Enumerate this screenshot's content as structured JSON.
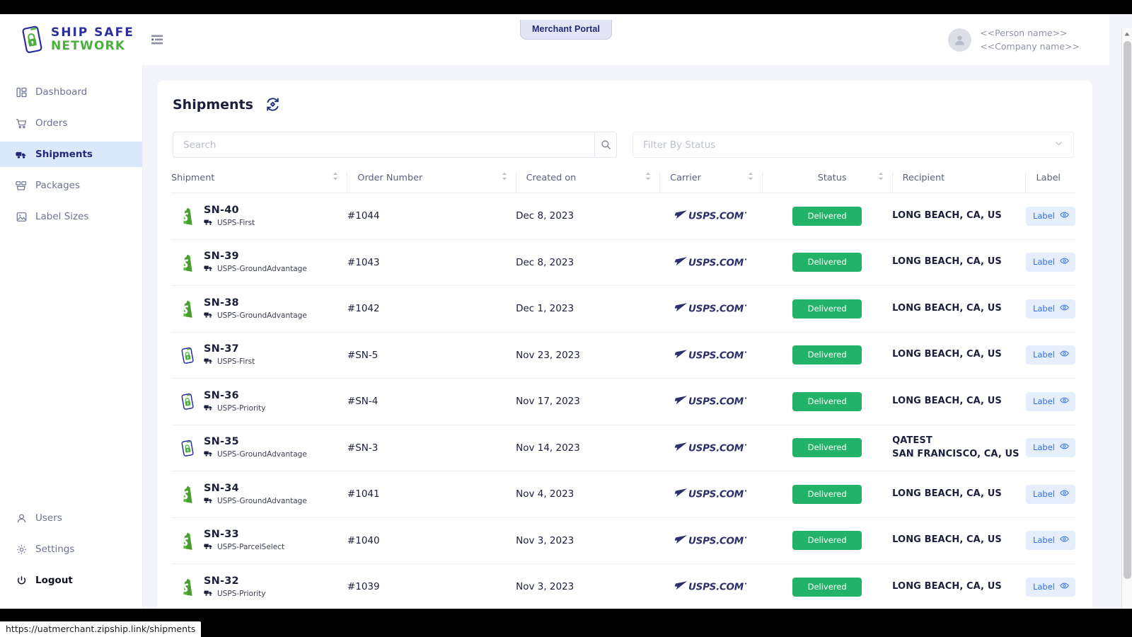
{
  "browser": {
    "tab_label": "Merchant Portal",
    "status_url": "https://uatmerchant.zipship.link/shipments"
  },
  "header": {
    "logo_line1": "SHIP SAFE",
    "logo_line2": "NETWORK",
    "menu_icon": "collapse-menu-icon",
    "person_name": "<<Person name>>",
    "company_name": "<<Company name>>"
  },
  "sidebar": {
    "top_items": [
      {
        "label": "Dashboard",
        "icon": "dashboard-icon",
        "active": false
      },
      {
        "label": "Orders",
        "icon": "cart-icon",
        "active": false
      },
      {
        "label": "Shipments",
        "icon": "truck-icon",
        "active": true
      },
      {
        "label": "Packages",
        "icon": "boxes-icon",
        "active": false
      },
      {
        "label": "Label Sizes",
        "icon": "image-icon",
        "active": false
      }
    ],
    "bottom_items": [
      {
        "label": "Users",
        "icon": "user-icon",
        "strong": false
      },
      {
        "label": "Settings",
        "icon": "gear-icon",
        "strong": false
      },
      {
        "label": "Logout",
        "icon": "power-icon",
        "strong": true
      }
    ]
  },
  "main": {
    "title": "Shipments",
    "refresh_icon": "refresh-sync-icon",
    "search": {
      "value": "",
      "placeholder": "Search",
      "icon": "search-icon"
    },
    "status_filter": {
      "value": "",
      "placeholder": "Filter By Status",
      "icon": "chevron-down-icon"
    },
    "columns": [
      {
        "label": "Shipment",
        "sortable": true
      },
      {
        "label": "Order Number",
        "sortable": true
      },
      {
        "label": "Created on",
        "sortable": true
      },
      {
        "label": "Carrier",
        "sortable": true
      },
      {
        "label": "Status",
        "sortable": true
      },
      {
        "label": "Recipient",
        "sortable": false
      },
      {
        "label": "Label",
        "sortable": false
      }
    ],
    "label_button_text": "Label",
    "carrier_logo": "usps-com-logo",
    "rows": [
      {
        "shipment": "SN-40",
        "service": "USPS-First",
        "source_icon": "shopify-icon",
        "order": "#1044",
        "created": "Dec 8, 2023",
        "carrier": "USPS.COM",
        "status": "Delivered",
        "recipient_line1": "LONG BEACH, CA, US",
        "recipient_line2": ""
      },
      {
        "shipment": "SN-39",
        "service": "USPS-GroundAdvantage",
        "source_icon": "shopify-icon",
        "order": "#1043",
        "created": "Dec 8, 2023",
        "carrier": "USPS.COM",
        "status": "Delivered",
        "recipient_line1": "LONG BEACH, CA, US",
        "recipient_line2": ""
      },
      {
        "shipment": "SN-38",
        "service": "USPS-GroundAdvantage",
        "source_icon": "shopify-icon",
        "order": "#1042",
        "created": "Dec 1, 2023",
        "carrier": "USPS.COM",
        "status": "Delivered",
        "recipient_line1": "LONG BEACH, CA, US",
        "recipient_line2": ""
      },
      {
        "shipment": "SN-37",
        "service": "USPS-First",
        "source_icon": "shipsafe-icon",
        "order": "#SN-5",
        "created": "Nov 23, 2023",
        "carrier": "USPS.COM",
        "status": "Delivered",
        "recipient_line1": "LONG BEACH, CA, US",
        "recipient_line2": ""
      },
      {
        "shipment": "SN-36",
        "service": "USPS-Priority",
        "source_icon": "shipsafe-icon",
        "order": "#SN-4",
        "created": "Nov 17, 2023",
        "carrier": "USPS.COM",
        "status": "Delivered",
        "recipient_line1": "LONG BEACH, CA, US",
        "recipient_line2": ""
      },
      {
        "shipment": "SN-35",
        "service": "USPS-GroundAdvantage",
        "source_icon": "shipsafe-icon",
        "order": "#SN-3",
        "created": "Nov 14, 2023",
        "carrier": "USPS.COM",
        "status": "Delivered",
        "recipient_line1": "QATEST",
        "recipient_line2": "SAN FRANCISCO, CA, US"
      },
      {
        "shipment": "SN-34",
        "service": "USPS-GroundAdvantage",
        "source_icon": "shopify-icon",
        "order": "#1041",
        "created": "Nov 4, 2023",
        "carrier": "USPS.COM",
        "status": "Delivered",
        "recipient_line1": "LONG BEACH, CA, US",
        "recipient_line2": ""
      },
      {
        "shipment": "SN-33",
        "service": "USPS-ParcelSelect",
        "source_icon": "shopify-icon",
        "order": "#1040",
        "created": "Nov 3, 2023",
        "carrier": "USPS.COM",
        "status": "Delivered",
        "recipient_line1": "LONG BEACH, CA, US",
        "recipient_line2": ""
      },
      {
        "shipment": "SN-32",
        "service": "USPS-Priority",
        "source_icon": "shopify-icon",
        "order": "#1039",
        "created": "Nov 3, 2023",
        "carrier": "USPS.COM",
        "status": "Delivered",
        "recipient_line1": "LONG BEACH, CA, US",
        "recipient_line2": ""
      }
    ]
  },
  "colors": {
    "brand_blue": "#2b2f9e",
    "brand_green": "#4cae3f",
    "active_nav_bg": "#dbe7fb",
    "status_green": "#22b368",
    "label_blue": "#2f6fed",
    "label_bg": "#e5effc"
  }
}
